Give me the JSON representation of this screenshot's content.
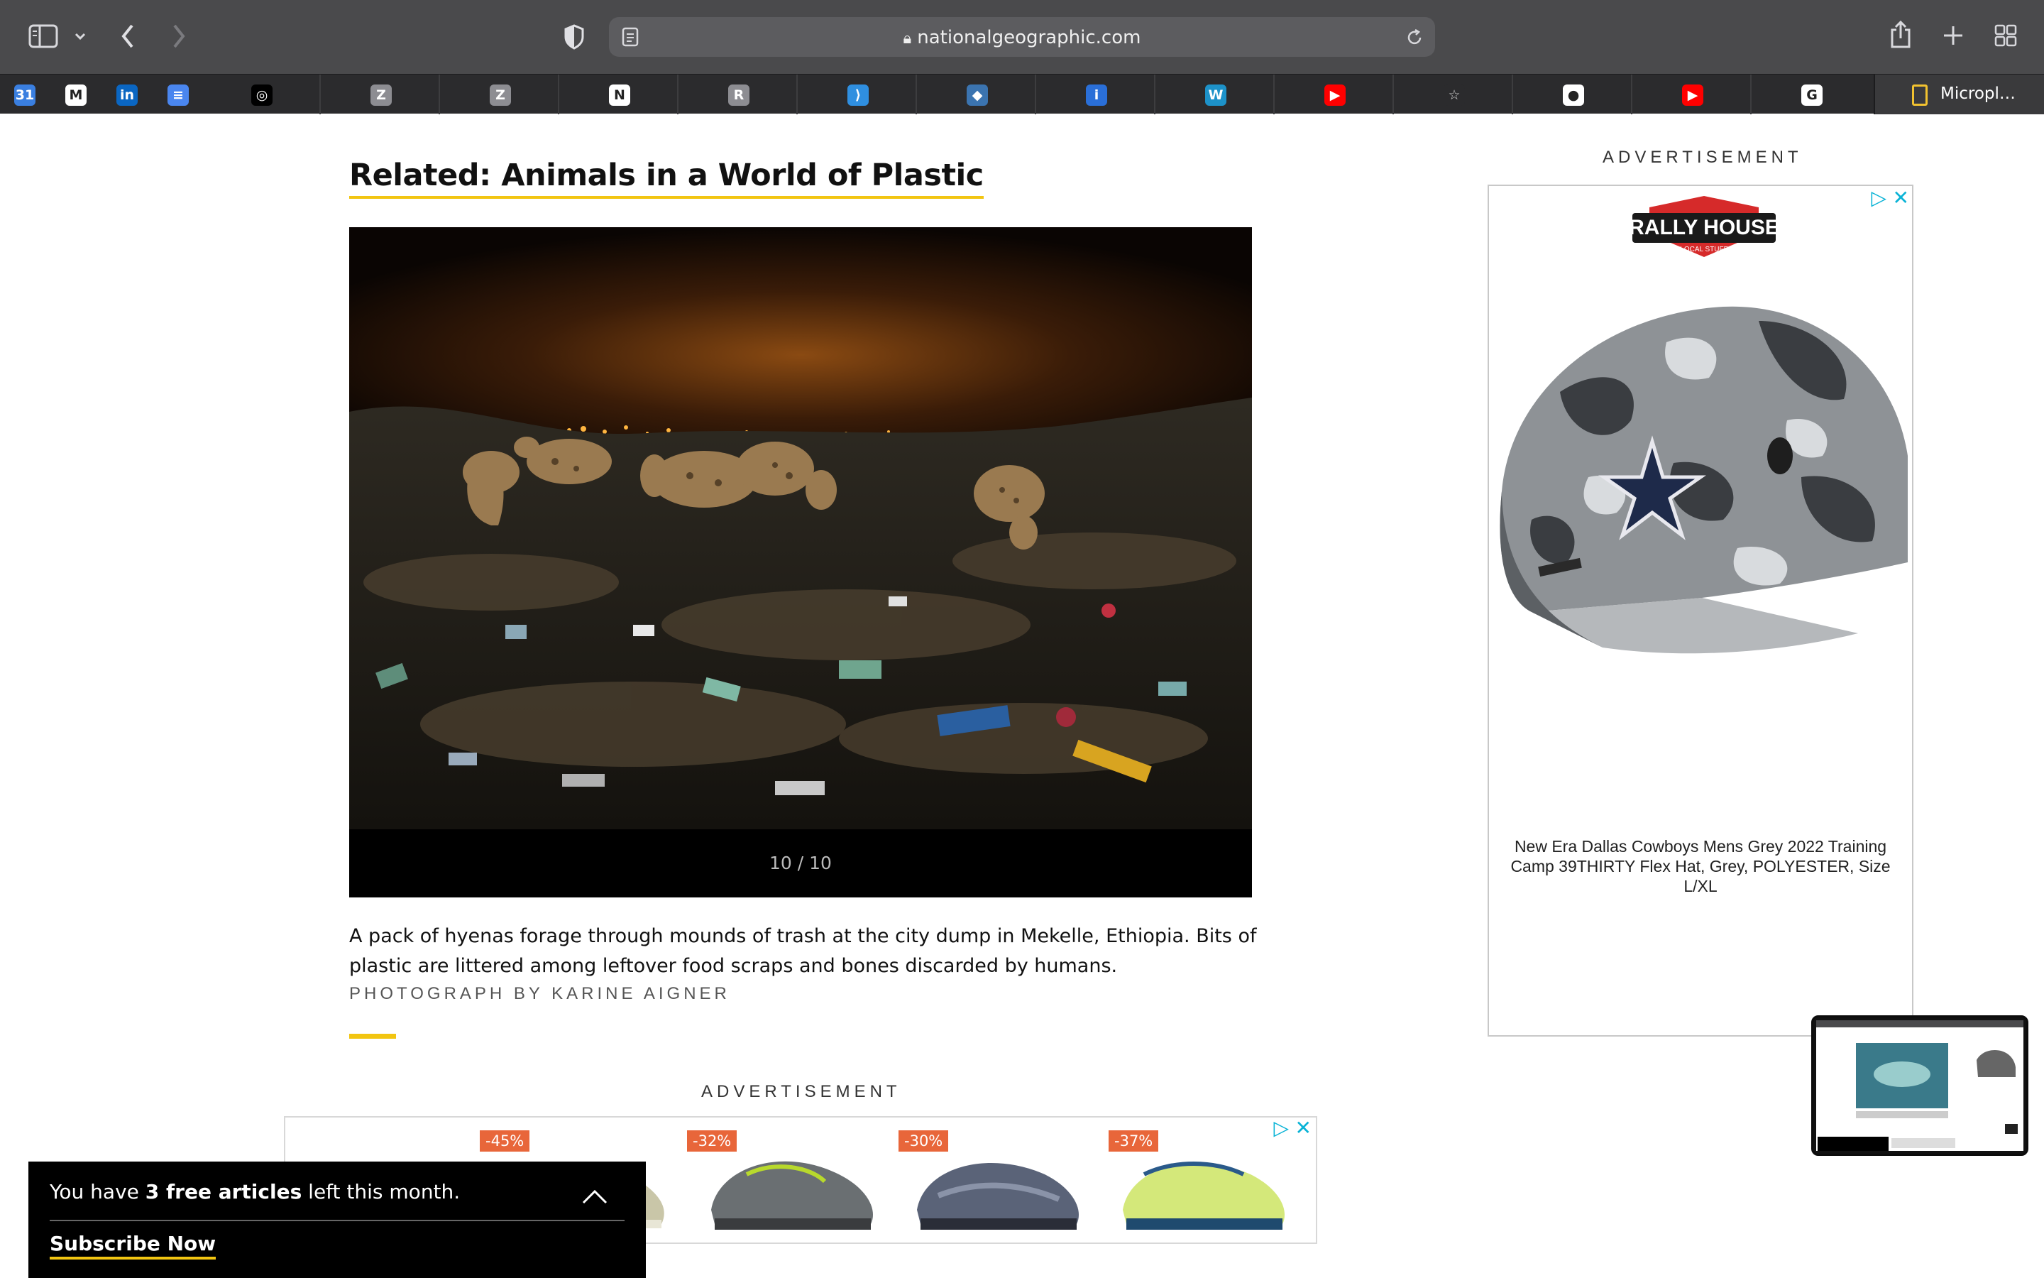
{
  "browser": {
    "url": "nationalgeographic.com",
    "favorites": [
      {
        "icon": "calendar-icon",
        "label": "31",
        "color": "#3a7fe0"
      },
      {
        "icon": "gmail-icon",
        "label": "M",
        "color": "#ffffff"
      },
      {
        "icon": "linkedin-icon",
        "label": "in",
        "color": "#0a66c2"
      },
      {
        "icon": "docs-icon",
        "label": "≡",
        "color": "#4a86ef"
      },
      {
        "icon": "spiral-app-icon",
        "label": "◎",
        "color": "#000000"
      },
      {
        "icon": "z-app-icon",
        "label": "Z",
        "color": "#8d8d92"
      },
      {
        "icon": "z-app-icon-2",
        "label": "Z",
        "color": "#8d8d92"
      },
      {
        "icon": "notion-icon",
        "label": "N",
        "color": "#ffffff"
      },
      {
        "icon": "r-app-icon",
        "label": "R",
        "color": "#8d8d92"
      },
      {
        "icon": "vscode-icon",
        "label": "⟩",
        "color": "#2f8fe0"
      },
      {
        "icon": "python-icon",
        "label": "◆",
        "color": "#3b74b0"
      },
      {
        "icon": "info-icon",
        "label": "i",
        "color": "#2a6fd8"
      },
      {
        "icon": "w-app-icon",
        "label": "W",
        "color": "#1d92c9"
      },
      {
        "icon": "youtube-icon",
        "label": "▶",
        "color": "#ff0000"
      },
      {
        "icon": "star-icon",
        "label": "☆",
        "color": "#2b2b2d"
      },
      {
        "icon": "github-icon",
        "label": "●",
        "color": "#ffffff"
      },
      {
        "icon": "youtube-icon-2",
        "label": "▶",
        "color": "#ff0000"
      },
      {
        "icon": "google-icon",
        "label": "G",
        "color": "#ffffff"
      }
    ],
    "last_favorite_label": "Micropl…"
  },
  "article": {
    "related_title": "Related: Animals in a World of Plastic",
    "counter": "10 / 10",
    "caption": "A pack of hyenas forage through mounds of trash at the city dump in Mekelle, Ethiopia. Bits of plastic are littered among leftover food scraps and bones discarded by humans.",
    "credit": "PHOTOGRAPH BY KARINE AIGNER"
  },
  "ads": {
    "label_top": "ADVERTISEMENT",
    "label_bottom": "ADVERTISEMENT",
    "right": {
      "brand": "RALLY HOUSE",
      "brand_sub": "LOCAL STUFF",
      "product": "New Era Dallas Cowboys Mens Grey 2022 Training Camp 39THIRTY Flex Hat, Grey, POLYESTER, Size L/XL"
    },
    "bottom_discounts": [
      "-45%",
      "-32%",
      "-30%",
      "-37%"
    ]
  },
  "paywall": {
    "text_before": "You have ",
    "count": "3 free articles",
    "text_after": " left this month.",
    "subscribe": "Subscribe Now"
  },
  "colors": {
    "accent_yellow": "#f2c511",
    "adchoices": "#0ab3d6",
    "discount": "#e8663a"
  }
}
